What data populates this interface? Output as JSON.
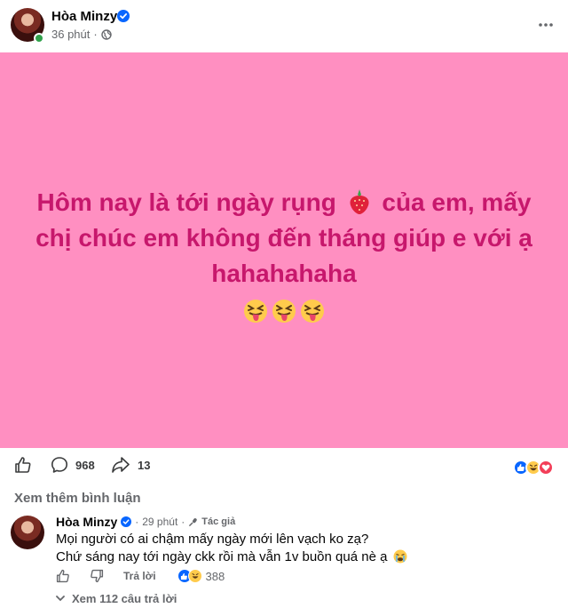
{
  "post": {
    "author": "Hòa Minzy",
    "time": "36 phút",
    "separator": "·",
    "text_line1": "Hôm nay là tới ngày rụng",
    "text_line1_after": "của em, mấy",
    "text_line2": "chị chúc em không đến tháng giúp e với ạ",
    "text_line3": "hahahahaha",
    "inline_emoji": "strawberry-icon",
    "emoji_row": [
      "squinting-tongue-emoji",
      "squinting-tongue-emoji",
      "squinting-tongue-emoji"
    ],
    "background_color": "#ff8fc1",
    "text_color": "#c7176c"
  },
  "actions": {
    "comments_count": "968",
    "shares_count": "13",
    "reactions": [
      "like-reaction",
      "haha-reaction",
      "love-reaction"
    ]
  },
  "comments_section": {
    "see_more_label": "Xem thêm bình luận"
  },
  "comment": {
    "author": "Hòa Minzy",
    "separator": "·",
    "time": "29 phút",
    "badge": "Tác giả",
    "line1": "Mọi người có ai chậm mấy ngày mới lên vạch ko zạ?",
    "line2": "Chứ sáng nay tới ngày ckk rồi mà vẫn 1v buồn quá nè ạ",
    "reply_label": "Trả lời",
    "reaction_count": "388",
    "see_replies_label": "Xem 112 câu trả lời"
  },
  "colors": {
    "accent_blue": "#0866ff",
    "secondary_text": "#65676b",
    "online_green": "#31a24c"
  }
}
